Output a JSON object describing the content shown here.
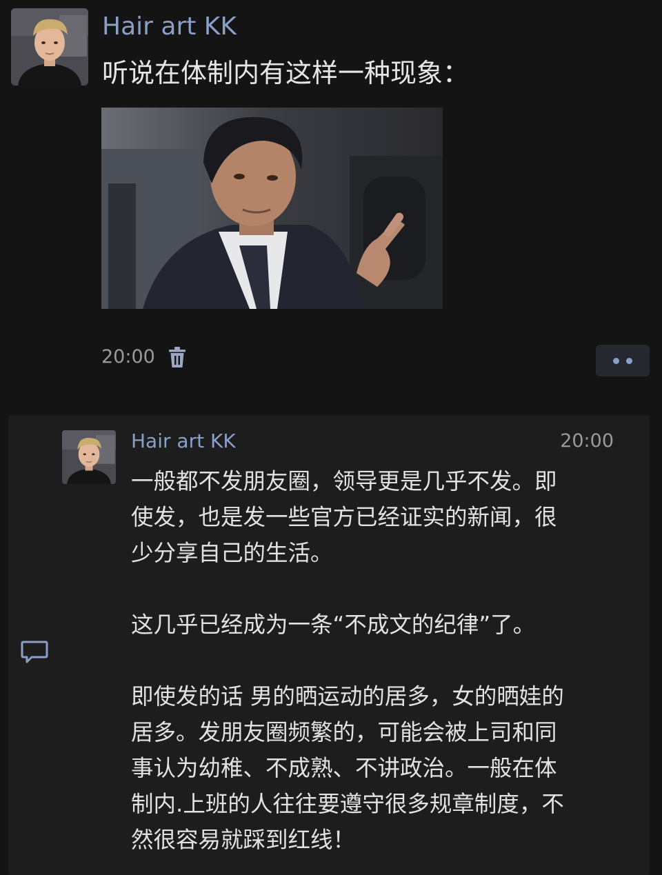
{
  "post": {
    "author": "Hair art KK",
    "text": "听说在体制内有这样一种现象：",
    "time": "20:00",
    "delete_icon": "trash-icon",
    "more_icon": "more-dots-icon"
  },
  "comment": {
    "author": "Hair art KK",
    "time": "20:00",
    "icon": "comment-bubble-icon",
    "paragraphs": [
      [
        "一般都不发朋友圈，领导更是几乎不发。即",
        "使发，也是发一些官方已经证实的新闻，很",
        "少分享自己的生活。"
      ],
      [
        "这几乎已经成为一条“不成文的纪律”了。"
      ],
      [
        "即使发的话 男的晒运动的居多，女的晒娃的",
        "居多。发朋友圈频繁的，可能会被上司和同",
        "事认为幼稚、不成熟、不讲政治。一般在体",
        "制内.上班的人往往要遵守很多规章制度，不",
        "然很容易就踩到红线！"
      ]
    ]
  },
  "colors": {
    "background": "#141414",
    "comment_panel": "#1d1d1d",
    "name_blue": "#8aa0c8",
    "text": "#e2e2e2",
    "muted": "#9a9a9a"
  }
}
